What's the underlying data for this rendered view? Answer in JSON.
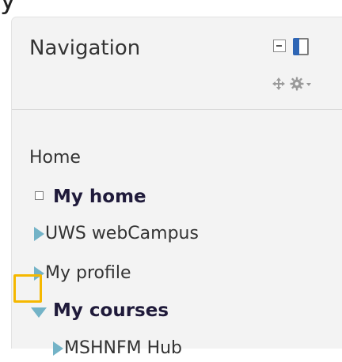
{
  "top_fragment": "y",
  "block": {
    "title": "Navigation"
  },
  "nav": {
    "home": "Home",
    "my_home": "My home",
    "uws_webcampus": "UWS webCampus",
    "my_profile": "My profile",
    "my_courses": "My courses",
    "mshnfm_hub": "MSHNFM Hub"
  },
  "colors": {
    "arrow": "#73b3c7",
    "highlight": "#f5b800",
    "dock_blue": "#2f66b5"
  }
}
